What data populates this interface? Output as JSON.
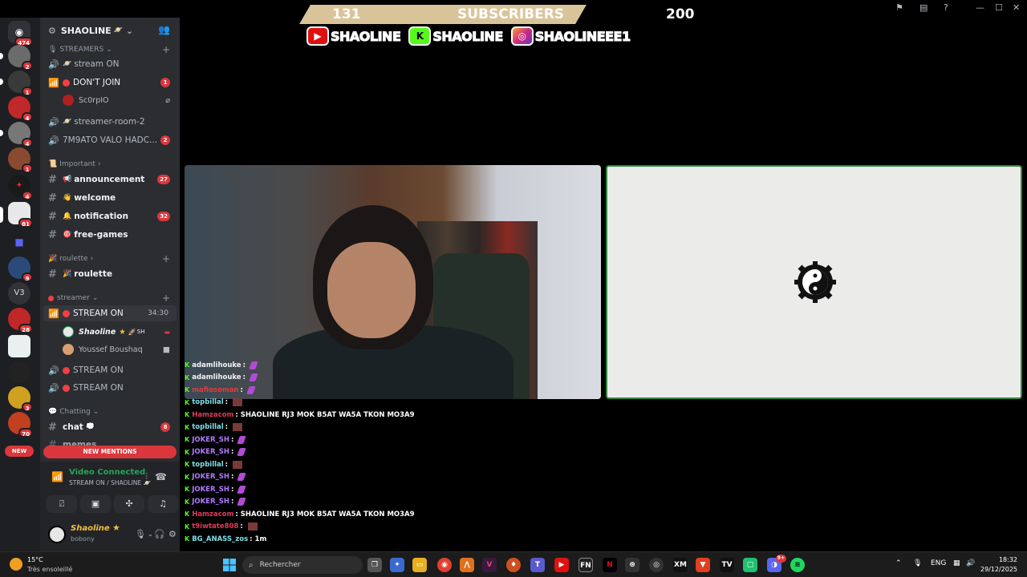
{
  "server": {
    "name": "SHAOLINE",
    "name_suffix": "🪐",
    "rail_home_badge": "474",
    "rail_badges": [
      "2",
      "1",
      "4",
      "4",
      "1",
      "4",
      "81",
      "9",
      "28",
      "3",
      "70"
    ],
    "rail_v3_label": "V3"
  },
  "categories": {
    "streamers": "STREAMERS",
    "important": "Important",
    "roulette": "roulette",
    "streamer": "streamer",
    "chatting": "Chatting"
  },
  "channels": {
    "stream_on_1": "stream ON",
    "dont_join": "DON'T JOIN",
    "dont_join_count": "1",
    "sc0rpio": "Sc0rpIO",
    "streamer_room_2": "streamer-room-2",
    "valo": "7M9ATO VALO HADC...",
    "valo_count": "2",
    "announcement": "announcement",
    "announcement_count": "27",
    "welcome": "welcome",
    "notification": "notification",
    "notification_count": "32",
    "free_games": "free-games",
    "roulette": "roulette",
    "stream_on_live": "STREAM ON",
    "stream_on_live_time": "34:30",
    "user_shaoline": "Shaoline",
    "user_shaoline_tag": "SH",
    "user_youssef": "Youssef Boushaq",
    "stream_on_2": "STREAM ON",
    "stream_on_3": "STREAM ON",
    "chat": "chat",
    "chat_count": "8",
    "memes": "memes"
  },
  "new_mentions": "NEW MENTIONS",
  "new_label": "NEW",
  "voice": {
    "status": "Video Connected",
    "location": "STREAM ON / SHAOLINE 🪐"
  },
  "me": {
    "name": "Shaoline",
    "status": "bobony"
  },
  "overlay": {
    "sub_count": "131",
    "sub_label": "SUBSCRIBERS",
    "sub_goal": "200",
    "youtube": "SHAOLINE",
    "kick": "SHAOLINE",
    "instagram": "SHAOLINEEE1"
  },
  "chat": [
    {
      "user": "adamlihouke",
      "color": "#f2f3f5",
      "text": "",
      "emote": "p"
    },
    {
      "user": "adamlihouke",
      "color": "#f2f3f5",
      "text": "",
      "emote": "p"
    },
    {
      "user": "mafiosoman",
      "color": "#e03c3c",
      "text": "",
      "emote": "p"
    },
    {
      "user": "topbillal",
      "color": "#7ee0e8",
      "text": "",
      "emote": "b"
    },
    {
      "user": "Hamzacom",
      "color": "#e03c5a",
      "text": "SHAOLINE RJ3 MOK B5AT WA5A TKON MO3A9",
      "emote": ""
    },
    {
      "user": "topbillal",
      "color": "#7ee0e8",
      "text": "",
      "emote": "b"
    },
    {
      "user": "JOKER_SH",
      "color": "#b07cff",
      "text": "",
      "emote": "p"
    },
    {
      "user": "JOKER_SH",
      "color": "#b07cff",
      "text": "",
      "emote": "p"
    },
    {
      "user": "topbillal",
      "color": "#7ee0e8",
      "text": "",
      "emote": "b"
    },
    {
      "user": "JOKER_SH",
      "color": "#b07cff",
      "text": "",
      "emote": "p"
    },
    {
      "user": "JOKER_SH",
      "color": "#b07cff",
      "text": "",
      "emote": "p"
    },
    {
      "user": "JOKER_SH",
      "color": "#b07cff",
      "text": "",
      "emote": "p"
    },
    {
      "user": "Hamzacom",
      "color": "#e03c5a",
      "text": "SHAOLINE RJ3 MOK B5AT WA5A TKON MO3A9",
      "emote": ""
    },
    {
      "user": "t9iwtate808",
      "color": "#e03c5a",
      "text": "",
      "emote": "b"
    },
    {
      "user": "BG_ANASS_zos",
      "color": "#7ee0e8",
      "text": "1m",
      "emote": ""
    }
  ],
  "taskbar": {
    "temp": "15°C",
    "weather": "Très ensoleillé",
    "search": "Rechercher",
    "lang": "ENG",
    "time": "18:32",
    "date": "29/12/2025",
    "discord_badge": "9+"
  },
  "colors": {
    "accent_green": "#23a55a",
    "mention_red": "#da373c",
    "kick_green": "#53fc18"
  }
}
